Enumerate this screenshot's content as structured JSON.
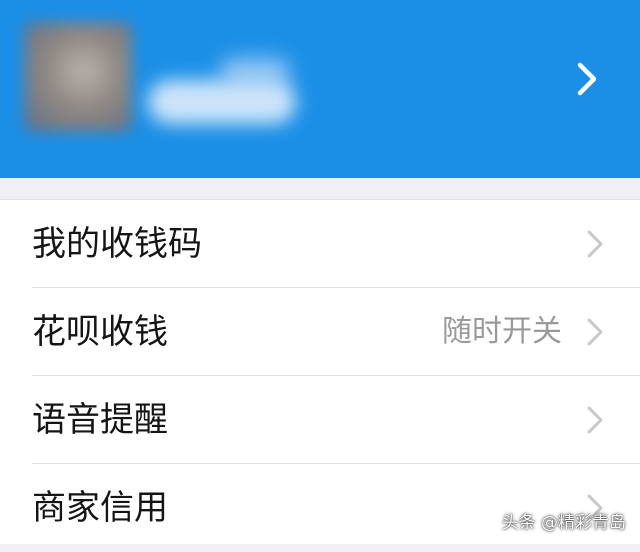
{
  "colors": {
    "header_bg": "#1b8fe6",
    "page_bg": "#efeff4",
    "label_text": "#151515",
    "value_text": "#9a9a9a",
    "chevron": "#c7c7cc"
  },
  "header": {
    "avatar_icon": "avatar-blurred",
    "chevron_icon": "chevron-right-icon"
  },
  "menu": {
    "items": [
      {
        "label": "我的收钱码",
        "value": "",
        "icon": "chevron-right-icon"
      },
      {
        "label": "花呗收钱",
        "value": "随时开关",
        "icon": "chevron-right-icon"
      },
      {
        "label": "语音提醒",
        "value": "",
        "icon": "chevron-right-icon"
      },
      {
        "label": "商家信用",
        "value": "",
        "icon": "chevron-right-icon"
      }
    ]
  },
  "watermark": {
    "text": "头条 @精彩青岛"
  }
}
